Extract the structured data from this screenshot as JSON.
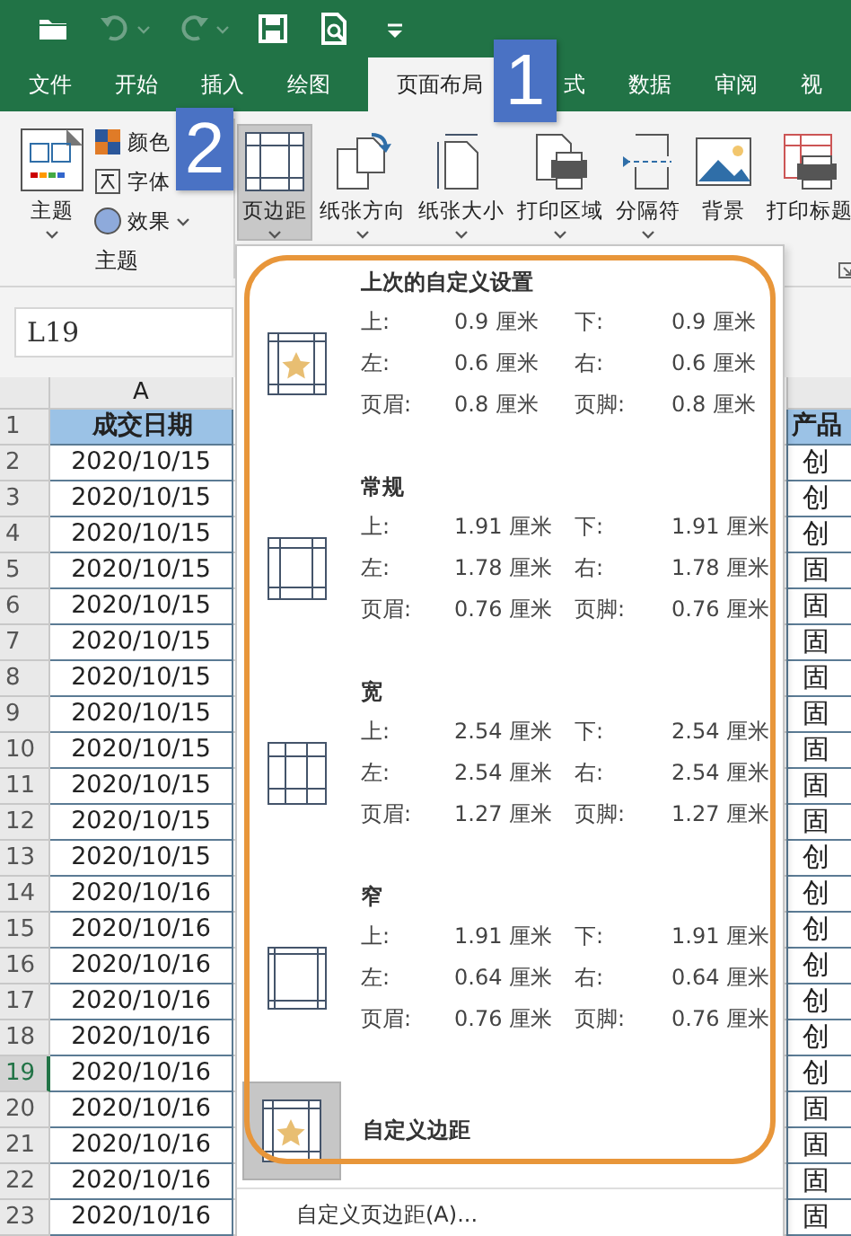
{
  "quick_access": [
    {
      "kind": "open",
      "disabled": false
    },
    {
      "kind": "undo",
      "disabled": true
    },
    {
      "kind": "redo",
      "disabled": true
    },
    {
      "kind": "save",
      "disabled": false
    },
    {
      "kind": "preview",
      "disabled": false
    },
    {
      "kind": "customize",
      "disabled": false
    }
  ],
  "tabs": [
    {
      "label": "文件",
      "selected": false
    },
    {
      "label": "开始",
      "selected": false
    },
    {
      "label": "插入",
      "selected": false
    },
    {
      "label": "绘图",
      "selected": false
    },
    {
      "label": "页面布局",
      "selected": true
    },
    {
      "label": "式",
      "selected": false
    },
    {
      "label": "数据",
      "selected": false
    },
    {
      "label": "审阅",
      "selected": false
    },
    {
      "label": "视",
      "selected": false
    }
  ],
  "badges": [
    {
      "text": "1"
    },
    {
      "text": "2"
    }
  ],
  "ribbon": {
    "theme_group": {
      "theme_button": {
        "label": "主题",
        "dropdown": true
      },
      "items": [
        {
          "kind": "colors",
          "label": "颜色",
          "dropdown": false
        },
        {
          "kind": "fonts",
          "label": "字体",
          "dropdown": false
        },
        {
          "kind": "effects",
          "label": "效果",
          "dropdown": true
        }
      ],
      "label": "主题"
    },
    "page_setup": [
      {
        "kind": "margins",
        "label": "页边距",
        "dropdown": true,
        "selected": true
      },
      {
        "kind": "orientation",
        "label": "纸张方向",
        "dropdown": true,
        "selected": false
      },
      {
        "kind": "size",
        "label": "纸张大小",
        "dropdown": true,
        "selected": false
      },
      {
        "kind": "print_area",
        "label": "打印区域",
        "dropdown": true,
        "selected": false
      },
      {
        "kind": "breaks",
        "label": "分隔符",
        "dropdown": true,
        "selected": false
      },
      {
        "kind": "background",
        "label": "背景",
        "dropdown": false,
        "selected": false
      },
      {
        "kind": "print_titles",
        "label": "打印标题",
        "dropdown": false,
        "selected": false
      }
    ]
  },
  "name_box": "L19",
  "sheet": {
    "column_header": "A",
    "rows": [
      {
        "number": "1",
        "kind": "header",
        "date": "成交日期",
        "product": "产品",
        "selected": false
      },
      {
        "number": "2",
        "kind": "data",
        "date": "2020/10/15",
        "product": "创",
        "selected": false
      },
      {
        "number": "3",
        "kind": "data",
        "date": "2020/10/15",
        "product": "创",
        "selected": false
      },
      {
        "number": "4",
        "kind": "data",
        "date": "2020/10/15",
        "product": "创",
        "selected": false
      },
      {
        "number": "5",
        "kind": "data",
        "date": "2020/10/15",
        "product": "固",
        "selected": false
      },
      {
        "number": "6",
        "kind": "data",
        "date": "2020/10/15",
        "product": "固",
        "selected": false
      },
      {
        "number": "7",
        "kind": "data",
        "date": "2020/10/15",
        "product": "固",
        "selected": false
      },
      {
        "number": "8",
        "kind": "data",
        "date": "2020/10/15",
        "product": "固",
        "selected": false
      },
      {
        "number": "9",
        "kind": "data",
        "date": "2020/10/15",
        "product": "固",
        "selected": false
      },
      {
        "number": "10",
        "kind": "data",
        "date": "2020/10/15",
        "product": "固",
        "selected": false
      },
      {
        "number": "11",
        "kind": "data",
        "date": "2020/10/15",
        "product": "固",
        "selected": false
      },
      {
        "number": "12",
        "kind": "data",
        "date": "2020/10/15",
        "product": "固",
        "selected": false
      },
      {
        "number": "13",
        "kind": "data",
        "date": "2020/10/15",
        "product": "创",
        "selected": false
      },
      {
        "number": "14",
        "kind": "data",
        "date": "2020/10/16",
        "product": "创",
        "selected": false
      },
      {
        "number": "15",
        "kind": "data",
        "date": "2020/10/16",
        "product": "创",
        "selected": false
      },
      {
        "number": "16",
        "kind": "data",
        "date": "2020/10/16",
        "product": "创",
        "selected": false
      },
      {
        "number": "17",
        "kind": "data",
        "date": "2020/10/16",
        "product": "创",
        "selected": false
      },
      {
        "number": "18",
        "kind": "data",
        "date": "2020/10/16",
        "product": "创",
        "selected": false
      },
      {
        "number": "19",
        "kind": "data",
        "date": "2020/10/16",
        "product": "创",
        "selected": true
      },
      {
        "number": "20",
        "kind": "data",
        "date": "2020/10/16",
        "product": "固",
        "selected": false
      },
      {
        "number": "21",
        "kind": "data",
        "date": "2020/10/16",
        "product": "固",
        "selected": false
      },
      {
        "number": "22",
        "kind": "data",
        "date": "2020/10/16",
        "product": "固",
        "selected": false
      },
      {
        "number": "23",
        "kind": "data",
        "date": "2020/10/16",
        "product": "固",
        "selected": false
      }
    ]
  },
  "margins_menu": {
    "presets": [
      {
        "kind": "last_custom",
        "name": "上次的自定义设置",
        "values": [
          {
            "label": "上:",
            "value": "0.9 厘米"
          },
          {
            "label": "下:",
            "value": "0.9 厘米"
          },
          {
            "label": "左:",
            "value": "0.6 厘米"
          },
          {
            "label": "右:",
            "value": "0.6 厘米"
          },
          {
            "label": "页眉:",
            "value": "0.8 厘米"
          },
          {
            "label": "页脚:",
            "value": "0.8 厘米"
          }
        ]
      },
      {
        "kind": "normal",
        "name": "常规",
        "values": [
          {
            "label": "上:",
            "value": "1.91 厘米"
          },
          {
            "label": "下:",
            "value": "1.91 厘米"
          },
          {
            "label": "左:",
            "value": "1.78 厘米"
          },
          {
            "label": "右:",
            "value": "1.78 厘米"
          },
          {
            "label": "页眉:",
            "value": "0.76 厘米"
          },
          {
            "label": "页脚:",
            "value": "0.76 厘米"
          }
        ]
      },
      {
        "kind": "wide",
        "name": "宽",
        "values": [
          {
            "label": "上:",
            "value": "2.54 厘米"
          },
          {
            "label": "下:",
            "value": "2.54 厘米"
          },
          {
            "label": "左:",
            "value": "2.54 厘米"
          },
          {
            "label": "右:",
            "value": "2.54 厘米"
          },
          {
            "label": "页眉:",
            "value": "1.27 厘米"
          },
          {
            "label": "页脚:",
            "value": "1.27 厘米"
          }
        ]
      },
      {
        "kind": "narrow",
        "name": "窄",
        "values": [
          {
            "label": "上:",
            "value": "1.91 厘米"
          },
          {
            "label": "下:",
            "value": "1.91 厘米"
          },
          {
            "label": "左:",
            "value": "0.64 厘米"
          },
          {
            "label": "右:",
            "value": "0.64 厘米"
          },
          {
            "label": "页眉:",
            "value": "0.76 厘米"
          },
          {
            "label": "页脚:",
            "value": "0.76 厘米"
          }
        ]
      }
    ],
    "custom": {
      "label": "自定义边距",
      "selected": true
    },
    "footer": "自定义页边距(A)..."
  }
}
